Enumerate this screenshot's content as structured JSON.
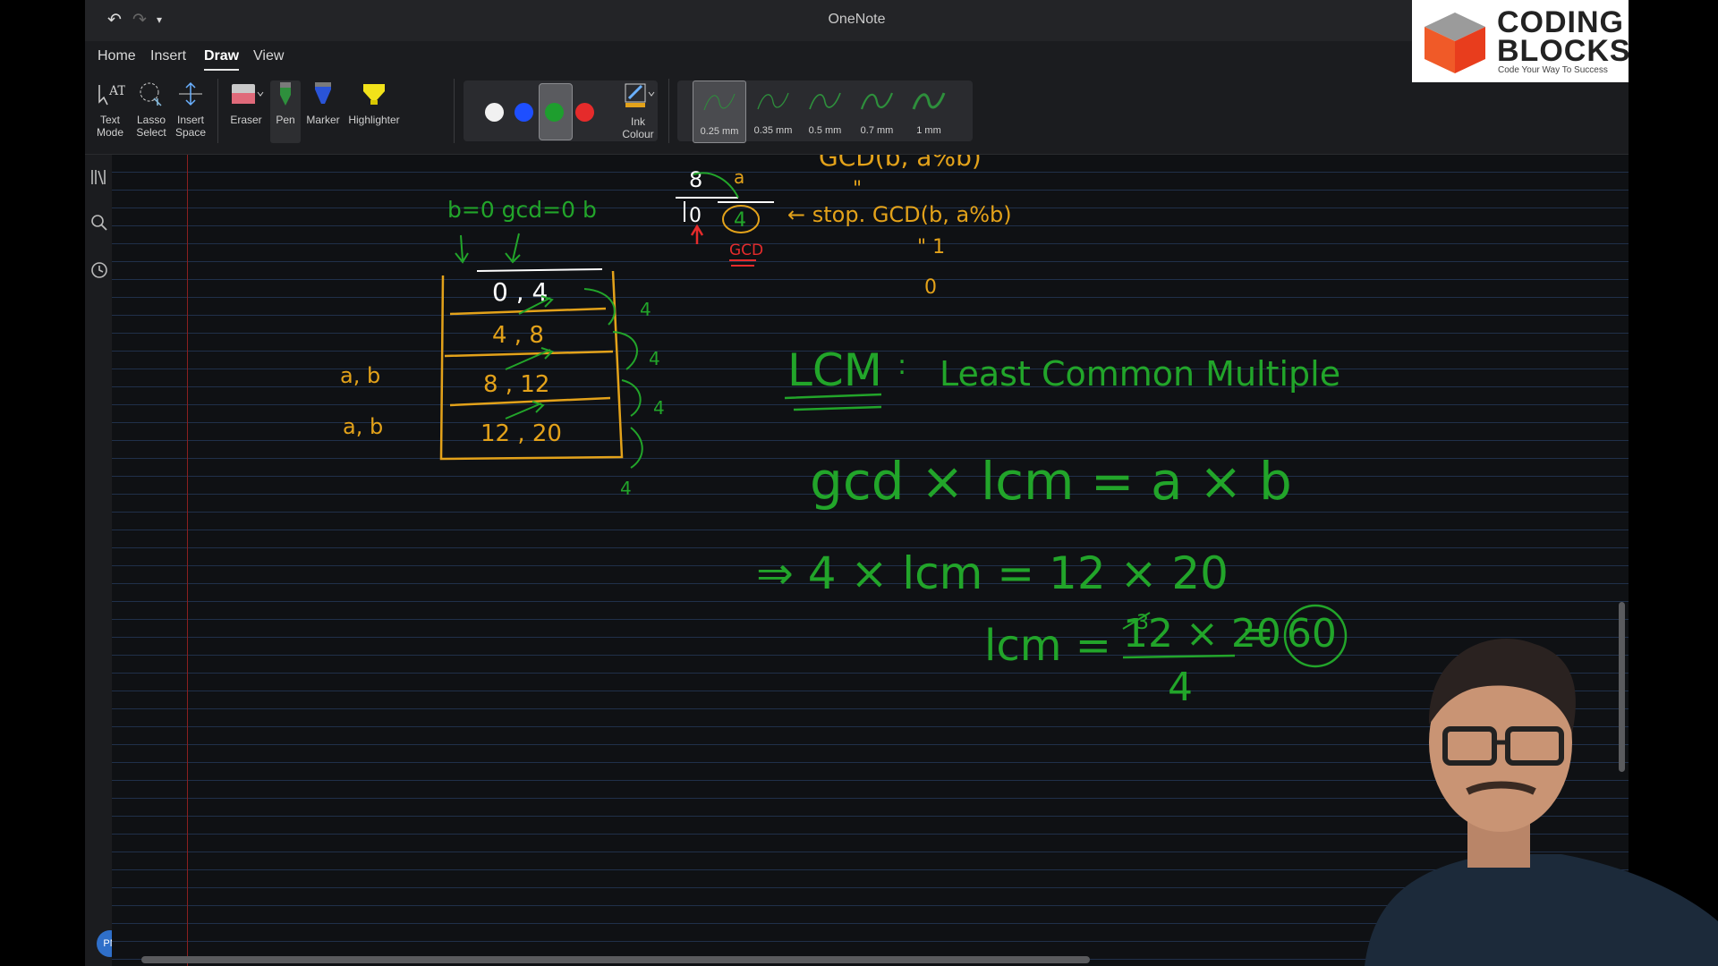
{
  "window": {
    "title": "OneNote"
  },
  "tabs": [
    {
      "label": "Home"
    },
    {
      "label": "Insert"
    },
    {
      "label": "Draw"
    },
    {
      "label": "View"
    }
  ],
  "tools": {
    "text_mode": "Text\nMode",
    "lasso": "Lasso\nSelect",
    "insert_space": "Insert\nSpace",
    "eraser": "Eraser",
    "pen": "Pen",
    "marker": "Marker",
    "highlighter": "Highlighter",
    "ink_colour": "Ink\nColour"
  },
  "colors": {
    "white": "#f1f1f1",
    "blue": "#1e4fff",
    "green": "#1e9e2e",
    "red": "#e52b2b",
    "ink_green": "#22a52a",
    "ink_orange": "#e3a21a"
  },
  "thickness": [
    "0.25 mm",
    "0.35 mm",
    "0.5 mm",
    "0.7 mm",
    "1 mm"
  ],
  "user": {
    "initials": "PN"
  },
  "logo": {
    "line1": "CODING",
    "line2": "BLOCKS",
    "tagline": "Code Your Way To Success"
  },
  "notes": {
    "top_formula": "GCD(b, a%b)",
    "stop_formula": "← stop. GCD(b, a%b)",
    "stop_marks": "\" 1",
    "zero": "0",
    "cond": "b=0  gcd=0  b",
    "gcd_label": "GCD",
    "eight": "8",
    "a_label": "a",
    "remainder": "0",
    "circled": "4",
    "rows": [
      "0 , 4",
      "4 , 8",
      "8 , 12",
      "12 , 20"
    ],
    "side_values": [
      "4",
      "4",
      "4",
      "4"
    ],
    "ab1": "a, b",
    "ab2": "a, b",
    "lcm_title": "LCM",
    "lcm_colon": ":",
    "lcm_full": "Least Common Multiple",
    "eq1": "gcd × lcm = a × b",
    "eq2": "⇒    4 × lcm = 12 × 20",
    "eq3_left": "lcm =",
    "eq3_num": "12 × 20",
    "eq3_den": "4",
    "eq3_three": "3",
    "eq3_result": "= 60"
  }
}
